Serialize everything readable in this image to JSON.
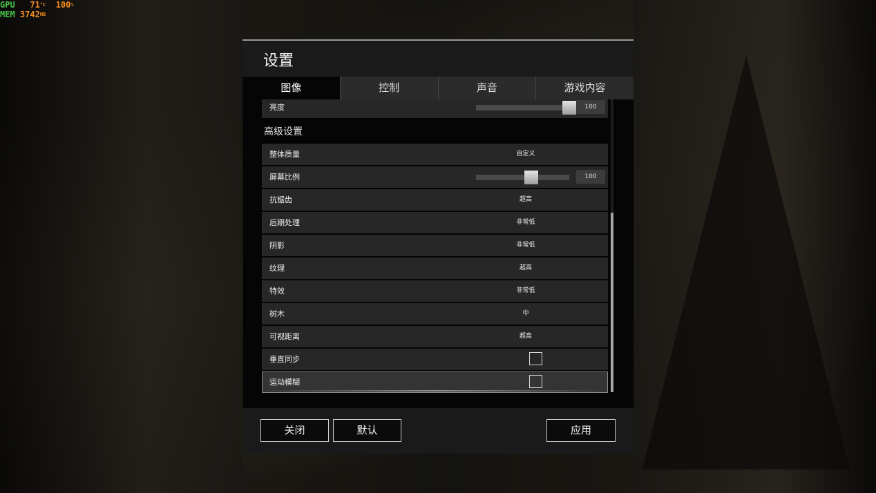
{
  "hud": {
    "gpu_label": "GPU",
    "gpu_temp": "71",
    "gpu_temp_unit": "°C",
    "gpu_usage": "100",
    "gpu_usage_unit": "%",
    "mem_label": "MEM",
    "mem_value": "3742",
    "mem_unit": "MB"
  },
  "dialog": {
    "title": "设置",
    "tabs": [
      {
        "label": "图像",
        "active": true
      },
      {
        "label": "控制",
        "active": false
      },
      {
        "label": "声音",
        "active": false
      },
      {
        "label": "游戏内容",
        "active": false
      }
    ],
    "brightness": {
      "label": "亮度",
      "value": "100",
      "level": 1.0
    },
    "advanced_header": "高级设置",
    "settings": [
      {
        "label": "整体质量",
        "value": "自定义"
      },
      {
        "label": "屏幕比例",
        "value": "100",
        "level": 0.58
      },
      {
        "label": "抗锯齿",
        "value": "超高"
      },
      {
        "label": "后期处理",
        "value": "非常低"
      },
      {
        "label": "阴影",
        "value": "非常低"
      },
      {
        "label": "纹理",
        "value": "超高"
      },
      {
        "label": "特效",
        "value": "非常低"
      },
      {
        "label": "树木",
        "value": "中"
      },
      {
        "label": "可视距离",
        "value": "超高"
      },
      {
        "label": "垂直同步",
        "checked": false
      },
      {
        "label": "运动模糊",
        "checked": false
      }
    ],
    "buttons": {
      "close": "关闭",
      "default": "默认",
      "apply": "应用"
    }
  }
}
